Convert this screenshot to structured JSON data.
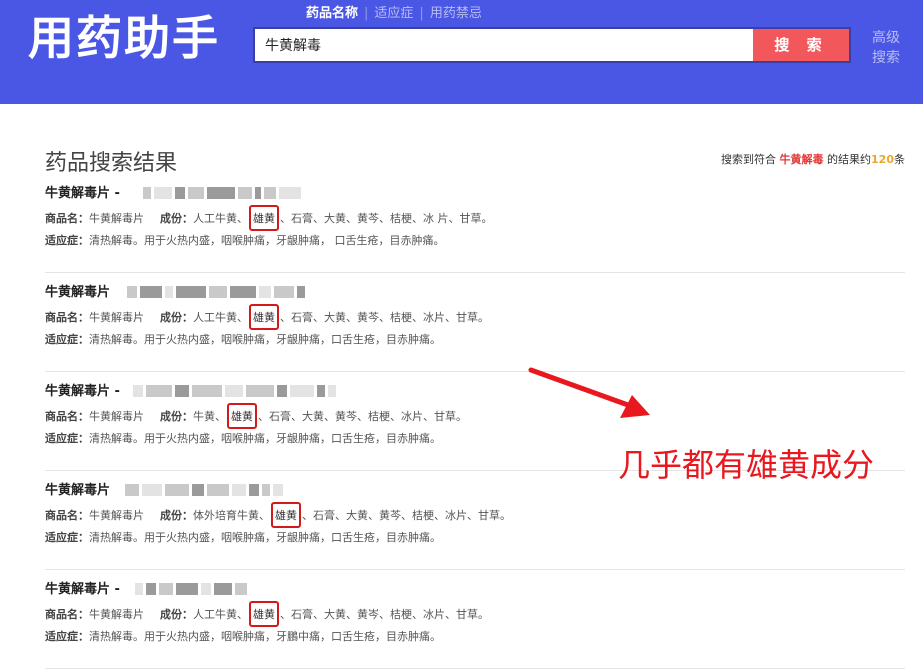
{
  "header": {
    "logo": "用药助手",
    "tabs": [
      {
        "label": "药品名称",
        "active": true
      },
      {
        "label": "适应症",
        "active": false
      },
      {
        "label": "用药禁忌",
        "active": false
      }
    ],
    "search_value": "牛黄解毒",
    "search_button": "搜 索",
    "advanced_line1": "高级",
    "advanced_line2": "搜索"
  },
  "results_header": {
    "title": "药品搜索结果",
    "summary_prefix": "搜索到符合",
    "summary_keyword": "牛黄解毒",
    "summary_mid": "的结果约",
    "summary_count": "120",
    "summary_suffix": "条"
  },
  "results": [
    {
      "title": "牛黄解毒片 -",
      "name_label": "商品名：",
      "name_value": "牛黄解毒片",
      "ingredients_label": "成份：",
      "ingredients_pre": "人工牛黄、",
      "ingredients_highlight": "雄黄",
      "ingredients_post": "、石膏、大黄、黄芩、桔梗、冰 片、甘草。",
      "indication_label": "适应症：",
      "indication_value": "清热解毒。用于火热内盛，咽喉肿痛，牙龈肿痛， 口舌生疮，目赤肿痛。"
    },
    {
      "title": "牛黄解毒片",
      "name_label": "商品名：",
      "name_value": "牛黄解毒片",
      "ingredients_label": "成份：",
      "ingredients_pre": "人工牛黄、",
      "ingredients_highlight": "雄黄",
      "ingredients_post": "、石膏、大黄、黄芩、桔梗、冰片、甘草。",
      "indication_label": "适应症：",
      "indication_value": "清热解毒。用于火热内盛，咽喉肿痛，牙龈肿痛，口舌生疮，目赤肿痛。"
    },
    {
      "title": "牛黄解毒片 -",
      "name_label": "商品名：",
      "name_value": "牛黄解毒片",
      "ingredients_label": "成份：",
      "ingredients_pre": "牛黄、",
      "ingredients_highlight": "雄黄",
      "ingredients_post": "、石膏、大黄、黄芩、桔梗、冰片、甘草。",
      "indication_label": "适应症：",
      "indication_value": "清热解毒。用于火热内盛，咽喉肿痛，牙龈肿痛，口舌生疮，目赤肿痛。"
    },
    {
      "title": "牛黄解毒片",
      "name_label": "商品名：",
      "name_value": "牛黄解毒片",
      "ingredients_label": "成份：",
      "ingredients_pre": "体外培育牛黄、",
      "ingredients_highlight": "雄黄",
      "ingredients_post": "、石膏、大黄、黄芩、桔梗、冰片、甘草。",
      "indication_label": "适应症：",
      "indication_value": "清热解毒。用于火热内盛，咽喉肿痛，牙龈肿痛，口舌生疮，目赤肿痛。"
    },
    {
      "title": "牛黄解毒片 -",
      "name_label": "商品名：",
      "name_value": "牛黄解毒片",
      "ingredients_label": "成份：",
      "ingredients_pre": "人工牛黄、",
      "ingredients_highlight": "雄黄",
      "ingredients_post": "、石膏、大黄、黄岑、桔梗、冰片、甘草。",
      "indication_label": "适应症：",
      "indication_value": "清热解毒。用于火热内盛，咽喉肿痛，牙鵬中痛，口舌生疮，目赤肿痛。"
    }
  ],
  "annotation": {
    "text": "几乎都有雄黄成分",
    "color": "#e8181e"
  },
  "colors": {
    "header_bg": "#4a57e5",
    "search_button": "#f2575b",
    "highlight_box": "#d31a1a",
    "keyword": "#e03a3a",
    "count": "#e8a92b"
  }
}
